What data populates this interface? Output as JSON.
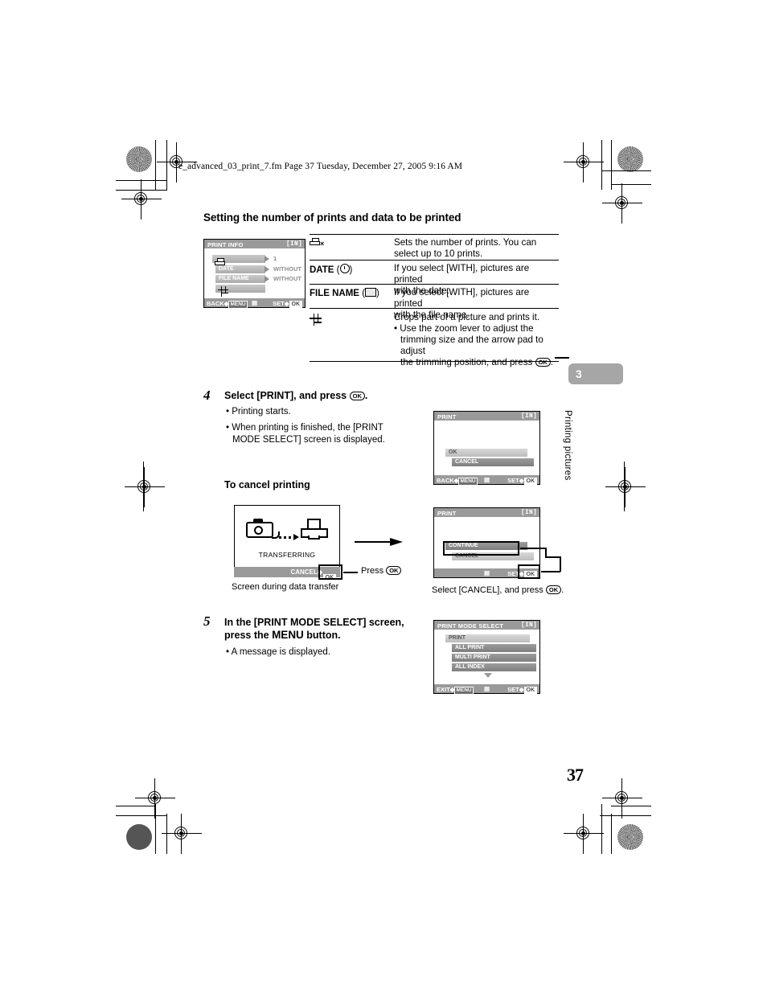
{
  "page": {
    "fm_header": "e_advanced_03_print_7.fm  Page 37  Tuesday, December 27, 2005  9:16 AM",
    "section_title": "Setting the number of prints and data to be printed",
    "page_number": "37",
    "chapter_number": "3",
    "chapter_label": "Printing pictures"
  },
  "print_info_screen": {
    "title": "PRINT INFO",
    "badge": "[IN]",
    "rows": [
      {
        "label": "",
        "value": "1",
        "icon": "printer-icon"
      },
      {
        "label": "DATE",
        "value": "WITHOUT",
        "icon": ""
      },
      {
        "label": "FILE NAME",
        "value": "WITHOUT",
        "icon": ""
      },
      {
        "label": "",
        "value": "",
        "icon": "crop-icon"
      }
    ],
    "footer_left": "BACK",
    "footer_left_key": "MENU",
    "footer_right": "SET",
    "footer_right_key": "OK"
  },
  "table": {
    "rows": [
      {
        "item_icon": "printer-multiply-icon",
        "item_label": "",
        "desc_lines": [
          "Sets the number of prints. You can",
          "select up to 10 prints."
        ]
      },
      {
        "item_icon": "clock-icon",
        "item_label": "DATE",
        "desc_lines": [
          "If you select [WITH], pictures are printed",
          "with the date."
        ]
      },
      {
        "item_icon": "file-icon",
        "item_label": "FILE NAME",
        "desc_lines": [
          "If you select [WITH], pictures are printed",
          "with the file name."
        ]
      },
      {
        "item_icon": "crop-icon",
        "item_label": "",
        "desc_lines": [
          "Crops part of a picture and prints it.",
          "• Use the zoom lever to adjust the",
          "trimming size and the arrow pad to adjust",
          "the trimming position, and press"
        ]
      }
    ]
  },
  "step4": {
    "number": "4",
    "heading_before": "Select [PRINT], and press",
    "heading_after": ".",
    "bullets": [
      "• Printing starts.",
      "• When printing is finished, the [PRINT",
      "MODE SELECT] screen is displayed."
    ],
    "subheading": "To cancel printing"
  },
  "print_screen_ok": {
    "title": "PRINT",
    "badge": "[IN]",
    "items": [
      "OK",
      "CANCEL"
    ],
    "footer_left": "BACK",
    "footer_left_key": "MENU",
    "footer_right": "SET",
    "footer_right_key": "OK"
  },
  "transfer_screen": {
    "status_text": "TRANSFERRING",
    "footer_label": "CANCEL",
    "footer_key": "OK",
    "caption": "Screen during data transfer",
    "press_label": "Press"
  },
  "print_screen_cancel": {
    "title": "PRINT",
    "badge": "[IN]",
    "items": [
      "CONTINUE",
      "CANCEL"
    ],
    "footer_right": "SET",
    "footer_right_key": "OK",
    "caption_before": "Select [CANCEL], and press",
    "caption_after": "."
  },
  "step5": {
    "number": "5",
    "heading_line1_a": "In the [PRINT MODE SELECT] screen,",
    "heading_line2_a": "press the ",
    "heading_line2_menu": "MENU",
    "heading_line2_b": " button.",
    "bullet": "• A message is displayed."
  },
  "print_mode_select_screen": {
    "title": "PRINT MODE SELECT",
    "badge": "[IN]",
    "items": [
      "PRINT",
      "ALL PRINT",
      "MULTI PRINT",
      "ALL INDEX"
    ],
    "footer_left": "EXIT",
    "footer_left_key": "MENU",
    "footer_right": "SET",
    "footer_right_key": "OK"
  },
  "colors": {
    "lcd_bar": "#9a9a9a",
    "menu_selected": "#cfcfcf",
    "menu_dark": "#8c8c8c",
    "chapter_tab": "#a6a6a6"
  }
}
